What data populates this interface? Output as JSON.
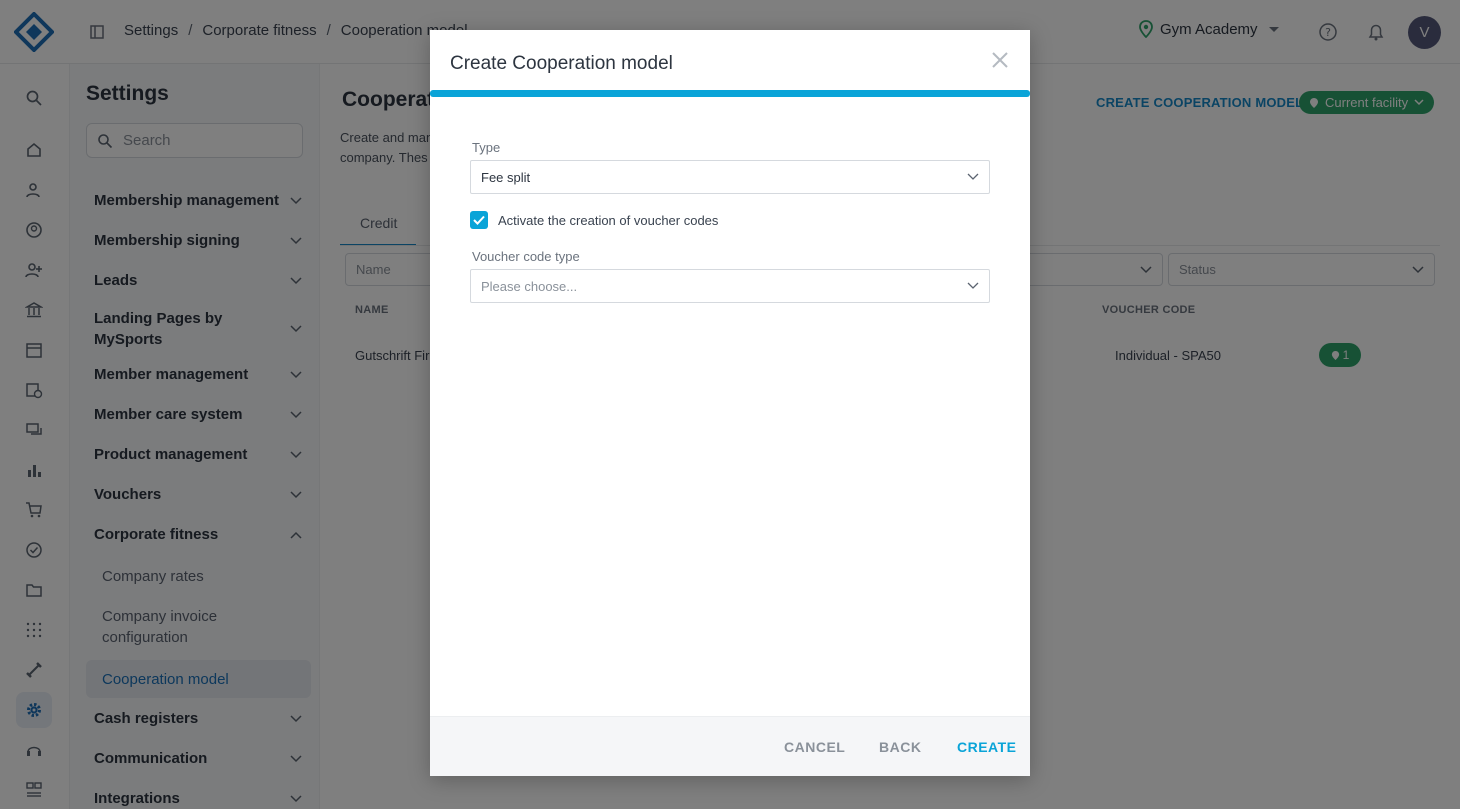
{
  "breadcrumb": [
    "Settings",
    "Corporate fitness",
    "Cooperation model"
  ],
  "header": {
    "facility": "Gym Academy",
    "avatar_initial": "V"
  },
  "rail_icons": [
    "search-icon",
    "home-icon",
    "member-check-icon",
    "account-circle-icon",
    "add-person-icon",
    "bank-icon",
    "calendar-icon",
    "calendar-clock-icon",
    "chat-icon",
    "bar-chart-icon",
    "cart-icon",
    "check-circle-icon",
    "folder-icon",
    "grid-dots-icon",
    "dumbbell-icon",
    "gear-icon",
    "headset-icon",
    "people-board-icon"
  ],
  "settings": {
    "title": "Settings",
    "search_placeholder": "Search",
    "menu": [
      {
        "label": "Membership management"
      },
      {
        "label": "Membership signing"
      },
      {
        "label": "Leads"
      },
      {
        "label": "Landing Pages by MySports"
      },
      {
        "label": "Member management"
      },
      {
        "label": "Member care system"
      },
      {
        "label": "Product management"
      },
      {
        "label": "Vouchers"
      },
      {
        "label": "Corporate fitness"
      },
      {
        "label": "Cash registers"
      },
      {
        "label": "Communication"
      },
      {
        "label": "Integrations"
      }
    ],
    "sub": [
      {
        "label": "Company rates"
      },
      {
        "label": "Company invoice configuration"
      },
      {
        "label": "Cooperation model"
      }
    ]
  },
  "main": {
    "title": "Cooperat",
    "desc_line1": "Create and man",
    "desc_line2": "company. Thes",
    "create_link": "CREATE COOPERATION MODEL",
    "current_facility": "Current facility",
    "tab": "Credit",
    "filter_name": "Name",
    "filter_status": "Status",
    "col_name": "NAME",
    "col_voucher": "VOUCHER CODE",
    "row_name": "Gutschrift Fir",
    "row_voucher": "Individual - SPA50",
    "row_badge": "1"
  },
  "modal": {
    "title": "Create Cooperation model",
    "type_label": "Type",
    "type_value": "Fee split",
    "checkbox_label": "Activate the creation of voucher codes",
    "checkbox_checked": true,
    "voucher_type_label": "Voucher code type",
    "voucher_type_placeholder": "Please choose...",
    "cancel": "CANCEL",
    "back": "BACK",
    "create": "CREATE"
  },
  "colors": {
    "accent": "#0aa4d8",
    "green": "#2fa36b",
    "link": "#1789c9"
  }
}
